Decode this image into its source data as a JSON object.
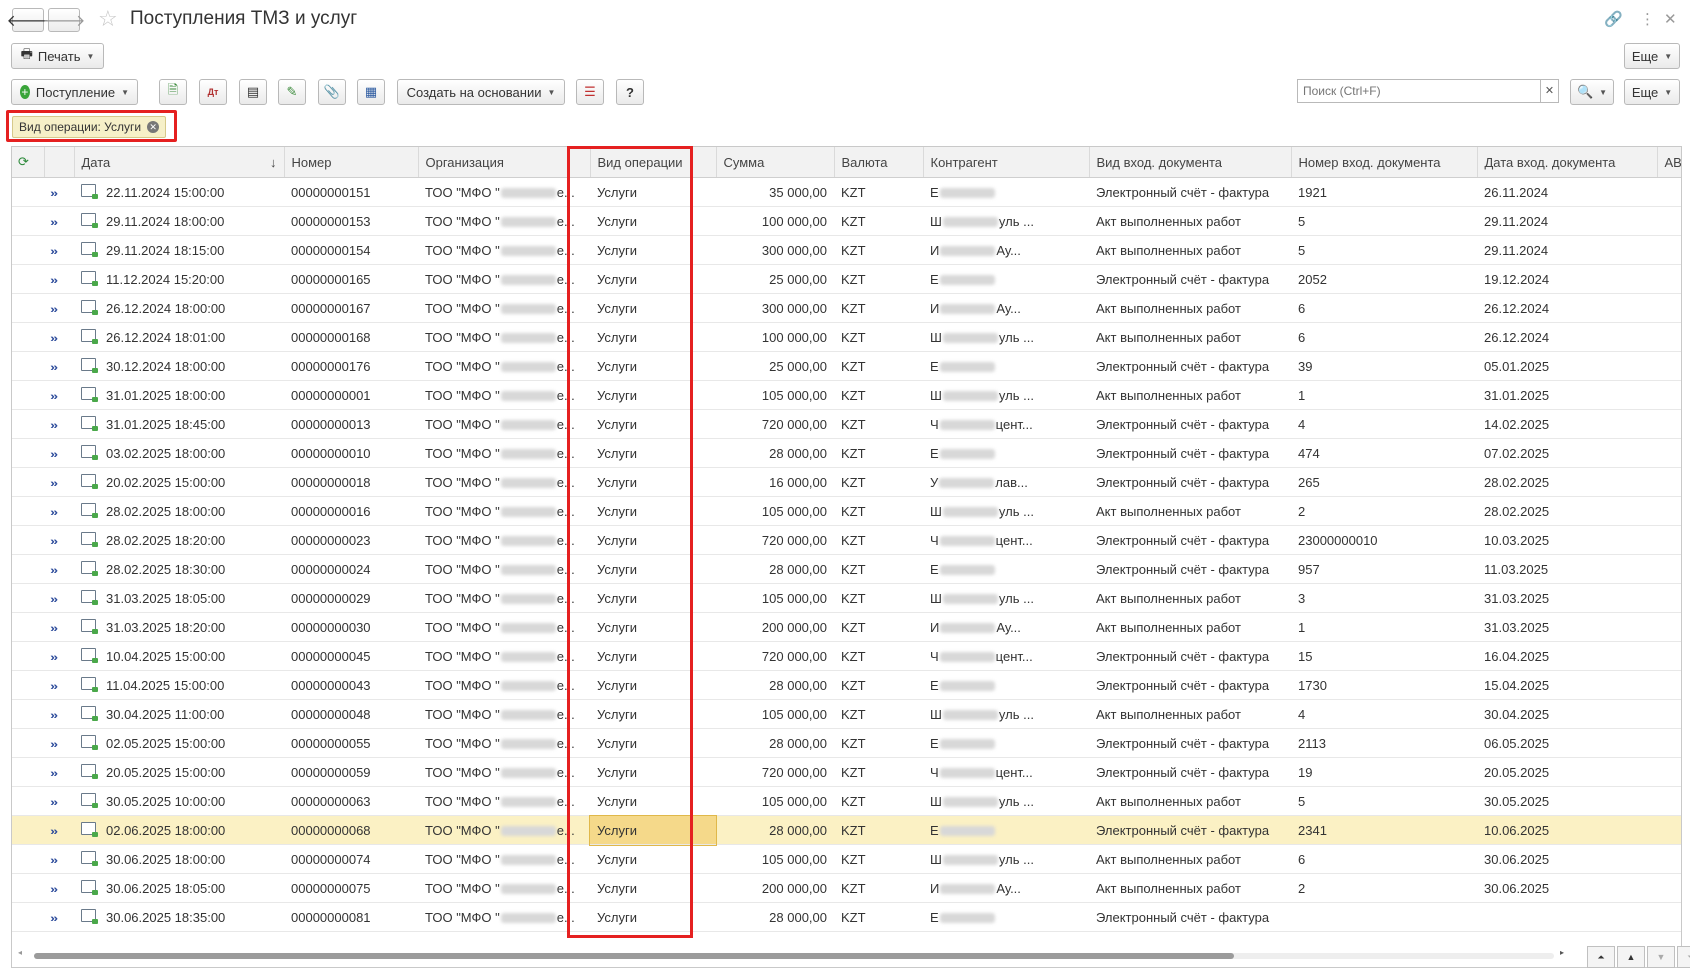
{
  "window": {
    "title": "Поступления ТМЗ и услуг"
  },
  "toolbar": {
    "print_label": "Печать",
    "more_label": "Еще",
    "receipt_label": "Поступление",
    "create_based_label": "Создать на основании",
    "help_label": "?",
    "more2_label": "Еще"
  },
  "search": {
    "placeholder": "Поиск (Ctrl+F)"
  },
  "filter": {
    "label": "Вид операции: Услуги"
  },
  "table": {
    "columns": [
      "Дата",
      "Номер",
      "Организация",
      "Вид операции",
      "Сумма",
      "Валюта",
      "Контрагент",
      "Вид вход. документа",
      "Номер вход. документа",
      "Дата вход. документа",
      "АВР"
    ],
    "sort_indicator": "↓",
    "rows": [
      {
        "date": "22.11.2024 15:00:00",
        "number": "00000000151",
        "org": "ТОО \"МФО \"",
        "org_tail": "е...",
        "op": "Услуги",
        "sum": "35 000,00",
        "cur": "KZT",
        "cp_head": "Е",
        "cp_tail": "",
        "doc": "Электронный счёт - фактура",
        "docno": "1921",
        "docdate": "26.11.2024"
      },
      {
        "date": "29.11.2024 18:00:00",
        "number": "00000000153",
        "org": "ТОО \"МФО \"",
        "org_tail": "е...",
        "op": "Услуги",
        "sum": "100 000,00",
        "cur": "KZT",
        "cp_head": "Ш",
        "cp_tail": "уль ...",
        "doc": "Акт выполненных работ",
        "docno": "5",
        "docdate": "29.11.2024"
      },
      {
        "date": "29.11.2024 18:15:00",
        "number": "00000000154",
        "org": "ТОО \"МФО \"",
        "org_tail": "е...",
        "op": "Услуги",
        "sum": "300 000,00",
        "cur": "KZT",
        "cp_head": "И",
        "cp_tail": "Ау...",
        "doc": "Акт выполненных работ",
        "docno": "5",
        "docdate": "29.11.2024"
      },
      {
        "date": "11.12.2024 15:20:00",
        "number": "00000000165",
        "org": "ТОО \"МФО \"",
        "org_tail": "е...",
        "op": "Услуги",
        "sum": "25 000,00",
        "cur": "KZT",
        "cp_head": "Е",
        "cp_tail": "",
        "doc": "Электронный счёт - фактура",
        "docno": "2052",
        "docdate": "19.12.2024"
      },
      {
        "date": "26.12.2024 18:00:00",
        "number": "00000000167",
        "org": "ТОО \"МФО \"",
        "org_tail": "е...",
        "op": "Услуги",
        "sum": "300 000,00",
        "cur": "KZT",
        "cp_head": "И",
        "cp_tail": "Ау...",
        "doc": "Акт выполненных работ",
        "docno": "6",
        "docdate": "26.12.2024"
      },
      {
        "date": "26.12.2024 18:01:00",
        "number": "00000000168",
        "org": "ТОО \"МФО \"",
        "org_tail": "е...",
        "op": "Услуги",
        "sum": "100 000,00",
        "cur": "KZT",
        "cp_head": "Ш",
        "cp_tail": "уль ...",
        "doc": "Акт выполненных работ",
        "docno": "6",
        "docdate": "26.12.2024"
      },
      {
        "date": "30.12.2024 18:00:00",
        "number": "00000000176",
        "org": "ТОО \"МФО \"",
        "org_tail": "е...",
        "op": "Услуги",
        "sum": "25 000,00",
        "cur": "KZT",
        "cp_head": "Е",
        "cp_tail": "",
        "doc": "Электронный счёт - фактура",
        "docno": "39",
        "docdate": "05.01.2025"
      },
      {
        "date": "31.01.2025 18:00:00",
        "number": "00000000001",
        "org": "ТОО \"МФО \"",
        "org_tail": "е...",
        "op": "Услуги",
        "sum": "105 000,00",
        "cur": "KZT",
        "cp_head": "Ш",
        "cp_tail": "уль ...",
        "doc": "Акт выполненных работ",
        "docno": "1",
        "docdate": "31.01.2025"
      },
      {
        "date": "31.01.2025 18:45:00",
        "number": "00000000013",
        "org": "ТОО \"МФО \"",
        "org_tail": "е...",
        "op": "Услуги",
        "sum": "720 000,00",
        "cur": "KZT",
        "cp_head": "Ч",
        "cp_tail": "цент...",
        "doc": "Электронный счёт - фактура",
        "docno": "4",
        "docdate": "14.02.2025"
      },
      {
        "date": "03.02.2025 18:00:00",
        "number": "00000000010",
        "org": "ТОО \"МФО \"",
        "org_tail": "е...",
        "op": "Услуги",
        "sum": "28 000,00",
        "cur": "KZT",
        "cp_head": "Е",
        "cp_tail": "",
        "doc": "Электронный счёт - фактура",
        "docno": "474",
        "docdate": "07.02.2025"
      },
      {
        "date": "20.02.2025 15:00:00",
        "number": "00000000018",
        "org": "ТОО \"МФО \"",
        "org_tail": "е...",
        "op": "Услуги",
        "sum": "16 000,00",
        "cur": "KZT",
        "cp_head": "У",
        "cp_tail": "лав...",
        "doc": "Электронный счёт - фактура",
        "docno": "265",
        "docdate": "28.02.2025"
      },
      {
        "date": "28.02.2025 18:00:00",
        "number": "00000000016",
        "org": "ТОО \"МФО \"",
        "org_tail": "е...",
        "op": "Услуги",
        "sum": "105 000,00",
        "cur": "KZT",
        "cp_head": "Ш",
        "cp_tail": "уль ...",
        "doc": "Акт выполненных работ",
        "docno": "2",
        "docdate": "28.02.2025"
      },
      {
        "date": "28.02.2025 18:20:00",
        "number": "00000000023",
        "org": "ТОО \"МФО \"",
        "org_tail": "е...",
        "op": "Услуги",
        "sum": "720 000,00",
        "cur": "KZT",
        "cp_head": "Ч",
        "cp_tail": "цент...",
        "doc": "Электронный счёт - фактура",
        "docno": "23000000010",
        "docdate": "10.03.2025"
      },
      {
        "date": "28.02.2025 18:30:00",
        "number": "00000000024",
        "org": "ТОО \"МФО \"",
        "org_tail": "е...",
        "op": "Услуги",
        "sum": "28 000,00",
        "cur": "KZT",
        "cp_head": "Е",
        "cp_tail": "",
        "doc": "Электронный счёт - фактура",
        "docno": "957",
        "docdate": "11.03.2025"
      },
      {
        "date": "31.03.2025 18:05:00",
        "number": "00000000029",
        "org": "ТОО \"МФО \"",
        "org_tail": "е...",
        "op": "Услуги",
        "sum": "105 000,00",
        "cur": "KZT",
        "cp_head": "Ш",
        "cp_tail": "уль ...",
        "doc": "Акт выполненных работ",
        "docno": "3",
        "docdate": "31.03.2025"
      },
      {
        "date": "31.03.2025 18:20:00",
        "number": "00000000030",
        "org": "ТОО \"МФО \"",
        "org_tail": "е...",
        "op": "Услуги",
        "sum": "200 000,00",
        "cur": "KZT",
        "cp_head": "И",
        "cp_tail": "Ау...",
        "doc": "Акт выполненных работ",
        "docno": "1",
        "docdate": "31.03.2025"
      },
      {
        "date": "10.04.2025 15:00:00",
        "number": "00000000045",
        "org": "ТОО \"МФО \"",
        "org_tail": "е...",
        "op": "Услуги",
        "sum": "720 000,00",
        "cur": "KZT",
        "cp_head": "Ч",
        "cp_tail": "цент...",
        "doc": "Электронный счёт - фактура",
        "docno": "15",
        "docdate": "16.04.2025"
      },
      {
        "date": "11.04.2025 15:00:00",
        "number": "00000000043",
        "org": "ТОО \"МФО \"",
        "org_tail": "е...",
        "op": "Услуги",
        "sum": "28 000,00",
        "cur": "KZT",
        "cp_head": "Е",
        "cp_tail": "",
        "doc": "Электронный счёт - фактура",
        "docno": "1730",
        "docdate": "15.04.2025"
      },
      {
        "date": "30.04.2025 11:00:00",
        "number": "00000000048",
        "org": "ТОО \"МФО \"",
        "org_tail": "е...",
        "op": "Услуги",
        "sum": "105 000,00",
        "cur": "KZT",
        "cp_head": "Ш",
        "cp_tail": "уль ...",
        "doc": "Акт выполненных работ",
        "docno": "4",
        "docdate": "30.04.2025"
      },
      {
        "date": "02.05.2025 15:00:00",
        "number": "00000000055",
        "org": "ТОО \"МФО \"",
        "org_tail": "е...",
        "op": "Услуги",
        "sum": "28 000,00",
        "cur": "KZT",
        "cp_head": "Е",
        "cp_tail": "",
        "doc": "Электронный счёт - фактура",
        "docno": "2113",
        "docdate": "06.05.2025"
      },
      {
        "date": "20.05.2025 15:00:00",
        "number": "00000000059",
        "org": "ТОО \"МФО \"",
        "org_tail": "е...",
        "op": "Услуги",
        "sum": "720 000,00",
        "cur": "KZT",
        "cp_head": "Ч",
        "cp_tail": "цент...",
        "doc": "Электронный счёт - фактура",
        "docno": "19",
        "docdate": "20.05.2025"
      },
      {
        "date": "30.05.2025 10:00:00",
        "number": "00000000063",
        "org": "ТОО \"МФО \"",
        "org_tail": "е...",
        "op": "Услуги",
        "sum": "105 000,00",
        "cur": "KZT",
        "cp_head": "Ш",
        "cp_tail": "уль ...",
        "doc": "Акт выполненных работ",
        "docno": "5",
        "docdate": "30.05.2025"
      },
      {
        "date": "02.06.2025 18:00:00",
        "number": "00000000068",
        "org": "ТОО \"МФО \"",
        "org_tail": "е...",
        "op": "Услуги",
        "sum": "28 000,00",
        "cur": "KZT",
        "cp_head": "Е",
        "cp_tail": "",
        "doc": "Электронный счёт - фактура",
        "docno": "2341",
        "docdate": "10.06.2025",
        "selected": true
      },
      {
        "date": "30.06.2025 18:00:00",
        "number": "00000000074",
        "org": "ТОО \"МФО \"",
        "org_tail": "е...",
        "op": "Услуги",
        "sum": "105 000,00",
        "cur": "KZT",
        "cp_head": "Ш",
        "cp_tail": "уль ...",
        "doc": "Акт выполненных работ",
        "docno": "6",
        "docdate": "30.06.2025"
      },
      {
        "date": "30.06.2025 18:05:00",
        "number": "00000000075",
        "org": "ТОО \"МФО \"",
        "org_tail": "е...",
        "op": "Услуги",
        "sum": "200 000,00",
        "cur": "KZT",
        "cp_head": "И",
        "cp_tail": "Ау...",
        "doc": "Акт выполненных работ",
        "docno": "2",
        "docdate": "30.06.2025"
      },
      {
        "date": "30.06.2025 18:35:00",
        "number": "00000000081",
        "org": "ТОО \"МФО \"",
        "org_tail": "е...",
        "op": "Услуги",
        "sum": "28 000,00",
        "cur": "KZT",
        "cp_head": "Е",
        "cp_tail": "",
        "doc": "Электронный счёт - фактура",
        "docno": "",
        "docdate": ""
      }
    ]
  },
  "colors": {
    "highlight_outline": "#e52020",
    "selected_row": "#fbf1c4",
    "filter_chip": "#f6f0c8"
  }
}
